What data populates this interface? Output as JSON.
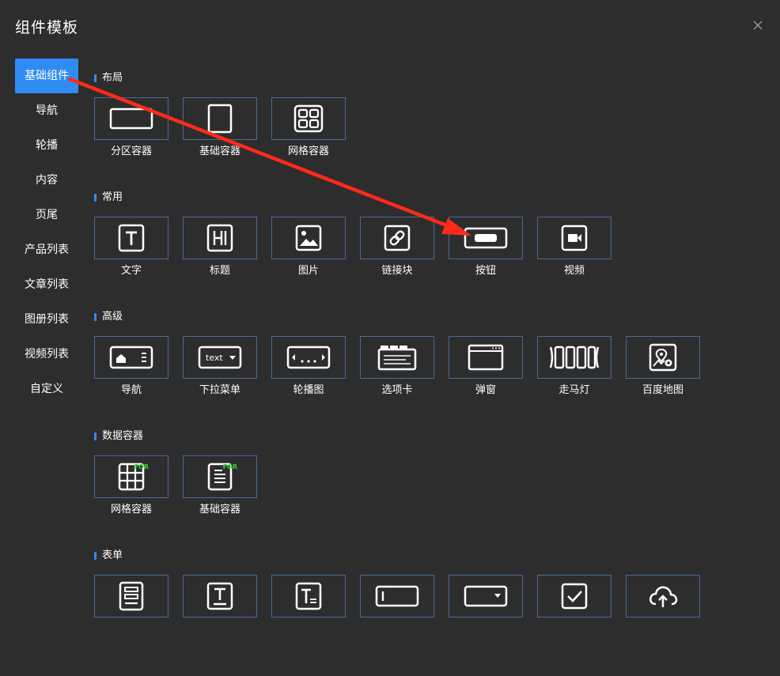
{
  "dialog": {
    "title": "组件模板"
  },
  "sidebar": {
    "items": [
      {
        "label": "基础组件",
        "active": true
      },
      {
        "label": "导航"
      },
      {
        "label": "轮播"
      },
      {
        "label": "内容"
      },
      {
        "label": "页尾"
      },
      {
        "label": "产品列表"
      },
      {
        "label": "文章列表"
      },
      {
        "label": "图册列表"
      },
      {
        "label": "视频列表"
      },
      {
        "label": "自定义"
      }
    ]
  },
  "sections": [
    {
      "title": "布局",
      "items": [
        {
          "label": "分区容器",
          "icon": "section-container-icon"
        },
        {
          "label": "基础容器",
          "icon": "basic-container-icon"
        },
        {
          "label": "网格容器",
          "icon": "grid-container-icon"
        }
      ]
    },
    {
      "title": "常用",
      "items": [
        {
          "label": "文字",
          "icon": "text-icon"
        },
        {
          "label": "标题",
          "icon": "heading-icon"
        },
        {
          "label": "图片",
          "icon": "image-icon"
        },
        {
          "label": "链接块",
          "icon": "link-icon"
        },
        {
          "label": "按钮",
          "icon": "button-icon"
        },
        {
          "label": "视频",
          "icon": "video-icon"
        }
      ]
    },
    {
      "title": "高级",
      "items": [
        {
          "label": "导航",
          "icon": "navbar-icon"
        },
        {
          "label": "下拉菜单",
          "icon": "dropdown-icon",
          "inner_text": "text"
        },
        {
          "label": "轮播图",
          "icon": "carousel-icon"
        },
        {
          "label": "选项卡",
          "icon": "tabs-icon"
        },
        {
          "label": "弹窗",
          "icon": "popup-icon"
        },
        {
          "label": "走马灯",
          "icon": "marquee-icon"
        },
        {
          "label": "百度地图",
          "icon": "map-icon"
        }
      ]
    },
    {
      "title": "数据容器",
      "items": [
        {
          "label": "网格容器",
          "icon": "data-grid-icon",
          "badge": "FOR"
        },
        {
          "label": "基础容器",
          "icon": "data-basic-icon",
          "badge": "FOR"
        }
      ]
    },
    {
      "title": "表单",
      "items": [
        {
          "label": "",
          "icon": "form-icon"
        },
        {
          "label": "",
          "icon": "text-input-icon"
        },
        {
          "label": "",
          "icon": "textarea-icon"
        },
        {
          "label": "",
          "icon": "input-box-icon"
        },
        {
          "label": "",
          "icon": "select-icon"
        },
        {
          "label": "",
          "icon": "checkbox-icon"
        },
        {
          "label": "",
          "icon": "upload-icon"
        }
      ]
    }
  ],
  "colors": {
    "accent": "#2f8cf5",
    "annotation_arrow": "#ff2a1a",
    "badge": "#3ad23a"
  }
}
